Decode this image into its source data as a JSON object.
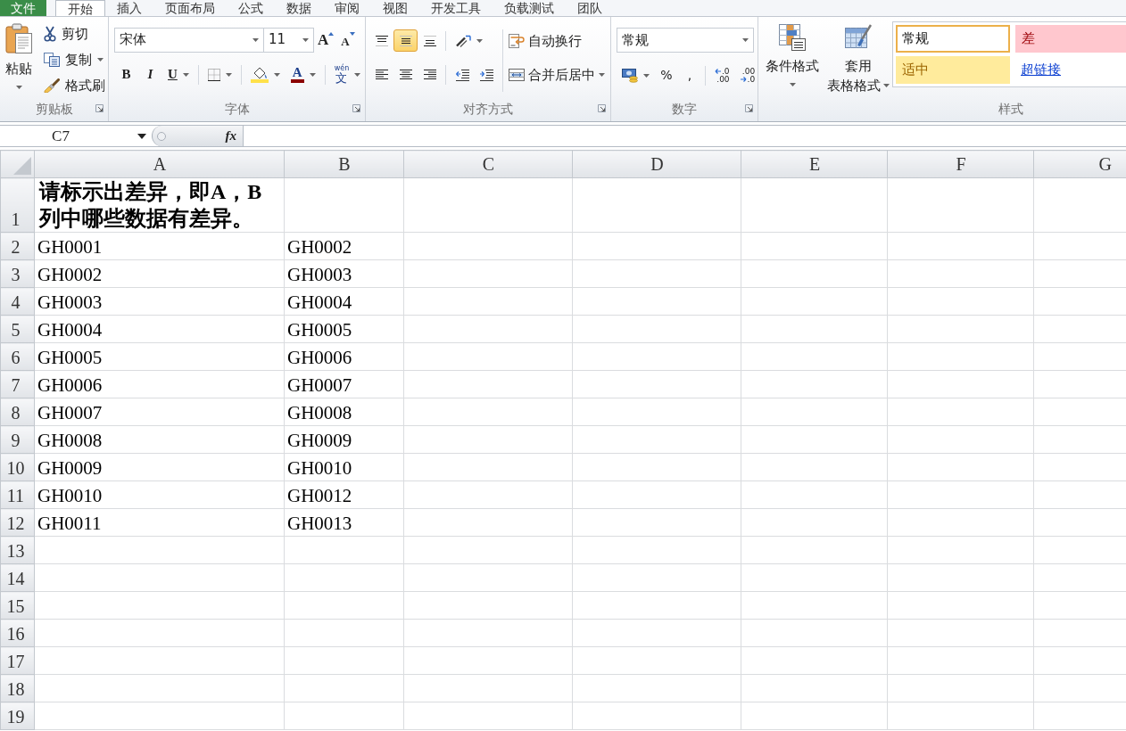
{
  "tabs": [
    {
      "label": "文件",
      "kind": "file",
      "selected": false
    },
    {
      "label": "开始",
      "kind": "tab",
      "selected": true
    },
    {
      "label": "插入",
      "kind": "tab",
      "selected": false
    },
    {
      "label": "页面布局",
      "kind": "tab",
      "selected": false
    },
    {
      "label": "公式",
      "kind": "tab",
      "selected": false
    },
    {
      "label": "数据",
      "kind": "tab",
      "selected": false
    },
    {
      "label": "审阅",
      "kind": "tab",
      "selected": false
    },
    {
      "label": "视图",
      "kind": "tab",
      "selected": false
    },
    {
      "label": "开发工具",
      "kind": "tab",
      "selected": false
    },
    {
      "label": "负载测试",
      "kind": "tab",
      "selected": false
    },
    {
      "label": "团队",
      "kind": "tab",
      "selected": false
    }
  ],
  "clipboard": {
    "label": "剪贴板",
    "launcher": true,
    "paste": "粘贴",
    "cut": "剪切",
    "copy": "复制",
    "format_painter": "格式刷"
  },
  "font": {
    "label": "字体",
    "launcher": true,
    "font_name": "宋体",
    "font_size": "11",
    "grow": "A",
    "shrink": "A",
    "bold": "B",
    "italic": "I",
    "underline": "U",
    "font_color": "A",
    "phonetic_top": "wén",
    "phonetic": "文"
  },
  "alignment": {
    "label": "对齐方式",
    "launcher": true,
    "vertical": [
      {
        "kind": "top",
        "selected": false
      },
      {
        "kind": "middle",
        "selected": true
      },
      {
        "kind": "bottom",
        "selected": false
      }
    ],
    "horizontal": [
      {
        "kind": "left",
        "selected": false
      },
      {
        "kind": "center",
        "selected": false
      },
      {
        "kind": "right",
        "selected": false
      }
    ],
    "wrap_text": "自动换行",
    "merge_center": "合并后居中"
  },
  "number": {
    "label": "数字",
    "launcher": true,
    "format": "常规",
    "percent": "%",
    "comma": ",",
    "increase_decimal": [
      ".0",
      ".00"
    ],
    "decrease_decimal": [
      ".00",
      ".0"
    ]
  },
  "styles": {
    "label": "样式",
    "launcher": false,
    "conditional_format": "条件格式",
    "format_as_table": [
      "套用",
      "表格格式"
    ],
    "cell_styles": [
      {
        "label": "常规",
        "kind": "normal",
        "selected": true
      },
      {
        "label": "差",
        "kind": "bad",
        "selected": false
      },
      {
        "label": "适中",
        "kind": "neutral",
        "selected": false
      },
      {
        "label": "超链接",
        "kind": "hyperlink",
        "selected": false
      }
    ]
  },
  "formula_bar": {
    "name_box": "C7",
    "function_label": "fx"
  },
  "sheet": {
    "columns": [
      "A",
      "B",
      "C",
      "D",
      "E",
      "F",
      "G"
    ],
    "rows": [
      {
        "header": "1",
        "bold": true,
        "wrap": true,
        "cells": [
          "请标示出差异，即A，B列中哪些数据有差异。"
        ]
      },
      {
        "header": "2",
        "cells": [
          "GH0001",
          "GH0002"
        ]
      },
      {
        "header": "3",
        "cells": [
          "GH0002",
          "GH0003"
        ]
      },
      {
        "header": "4",
        "cells": [
          "GH0003",
          "GH0004"
        ]
      },
      {
        "header": "5",
        "cells": [
          "GH0004",
          "GH0005"
        ]
      },
      {
        "header": "6",
        "cells": [
          "GH0005",
          "GH0006"
        ]
      },
      {
        "header": "7",
        "cells": [
          "GH0006",
          "GH0007"
        ]
      },
      {
        "header": "8",
        "cells": [
          "GH0007",
          "GH0008"
        ]
      },
      {
        "header": "9",
        "cells": [
          "GH0008",
          "GH0009"
        ]
      },
      {
        "header": "10",
        "cells": [
          "GH0009",
          "GH0010"
        ]
      },
      {
        "header": "11",
        "cells": [
          "GH0010",
          "GH0012"
        ]
      },
      {
        "header": "12",
        "cells": [
          "GH0011",
          "GH0013"
        ]
      },
      {
        "header": "13"
      },
      {
        "header": "14"
      },
      {
        "header": "15"
      },
      {
        "header": "16"
      },
      {
        "header": "17"
      },
      {
        "header": "18"
      },
      {
        "header": "19"
      }
    ]
  }
}
